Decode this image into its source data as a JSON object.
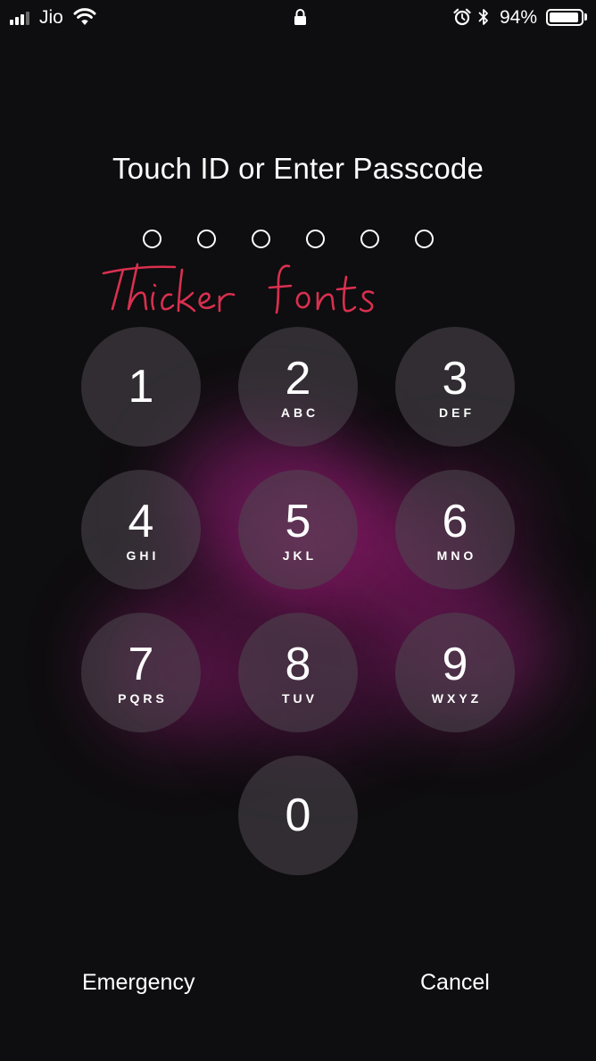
{
  "status_bar": {
    "carrier": "Jio",
    "signal_bars_total": 4,
    "signal_bars_active": 3,
    "battery_percent": "94%",
    "battery_level": 0.94,
    "icons": [
      "signal-icon",
      "wifi-icon",
      "lock-icon",
      "alarm-icon",
      "bluetooth-icon",
      "battery-icon"
    ]
  },
  "lock_screen": {
    "title": "Touch ID or Enter Passcode",
    "passcode_length": 6,
    "passcode_entered": 0,
    "annotation": "Thicker fonts",
    "annotation_color": "#d9304f"
  },
  "keypad": {
    "keys": [
      {
        "digit": "1",
        "letters": ""
      },
      {
        "digit": "2",
        "letters": "ABC"
      },
      {
        "digit": "3",
        "letters": "DEF"
      },
      {
        "digit": "4",
        "letters": "GHI"
      },
      {
        "digit": "5",
        "letters": "JKL"
      },
      {
        "digit": "6",
        "letters": "MNO"
      },
      {
        "digit": "7",
        "letters": "PQRS"
      },
      {
        "digit": "8",
        "letters": "TUV"
      },
      {
        "digit": "9",
        "letters": "WXYZ"
      },
      {
        "digit": "0",
        "letters": ""
      }
    ]
  },
  "actions": {
    "emergency_label": "Emergency",
    "cancel_label": "Cancel"
  },
  "colors": {
    "background": "#0e0d0f",
    "key_fill": "#4e4850",
    "glow": "#96207a",
    "text": "#ffffff"
  }
}
